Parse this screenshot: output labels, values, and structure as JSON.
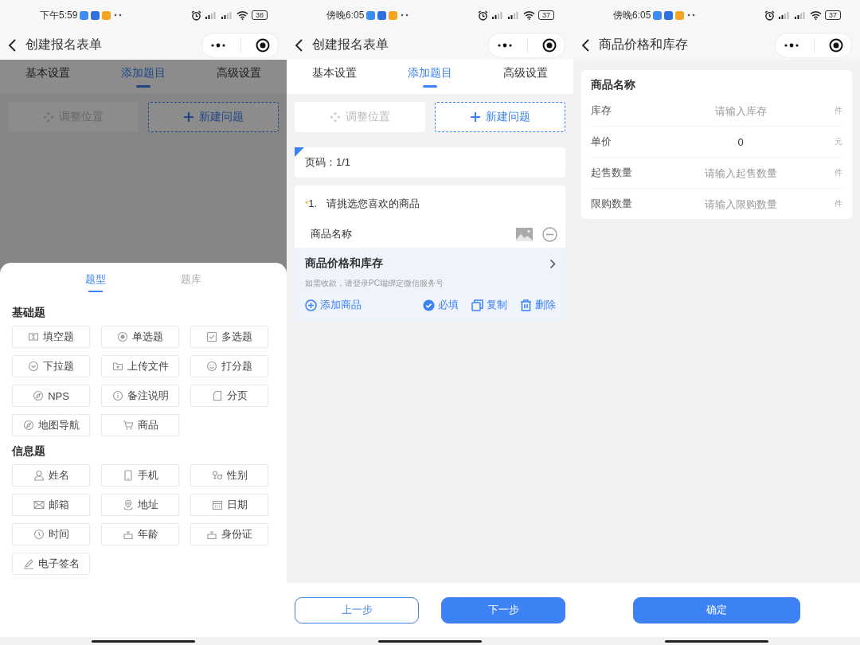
{
  "screens": [
    {
      "kind": "question_types",
      "status_bar": {
        "time": "下午5:59",
        "battery": "38"
      },
      "title": "创建报名表单",
      "tabs": [
        {
          "label": "基本设置",
          "selected": false
        },
        {
          "label": "添加题目",
          "selected": true
        },
        {
          "label": "高级设置",
          "selected": false
        }
      ],
      "actions": [
        {
          "label": "调整位置",
          "disabled": true
        },
        {
          "label": "新建问题",
          "disabled": false
        }
      ],
      "sheet": {
        "tabs": [
          {
            "label": "题型",
            "selected": true
          },
          {
            "label": "题库",
            "selected": false
          }
        ],
        "groups": [
          {
            "title": "基础题",
            "items": [
              "填空题",
              "单选题",
              "多选题",
              "下拉题",
              "上传文件",
              "打分题",
              "NPS",
              "备注说明",
              "分页",
              "地图导航",
              "商品"
            ]
          },
          {
            "title": "信息题",
            "items": [
              "姓名",
              "手机",
              "性别",
              "邮箱",
              "地址",
              "日期",
              "时间",
              "年龄",
              "身份证",
              "电子签名"
            ]
          }
        ]
      }
    },
    {
      "kind": "editor",
      "status_bar": {
        "time": "傍晚6:05",
        "battery": "37"
      },
      "title": "创建报名表单",
      "tabs": [
        {
          "label": "基本设置",
          "selected": false
        },
        {
          "label": "添加题目",
          "selected": true
        },
        {
          "label": "高级设置",
          "selected": false
        }
      ],
      "actions": [
        {
          "label": "调整位置",
          "disabled": true
        },
        {
          "label": "新建问题",
          "disabled": false
        }
      ],
      "page_label": "页码：1/1",
      "question": {
        "required_mark": "*",
        "number": "1.",
        "title": "请挑选您喜欢的商品",
        "options": [
          "商品名称"
        ],
        "price_section": {
          "title": "商品价格和库存",
          "hint": "如需收款，请登录PC端绑定微信服务号"
        },
        "tools": [
          {
            "kind": "add",
            "label": "添加商品"
          },
          {
            "kind": "required",
            "label": "必填",
            "checked": true
          },
          {
            "kind": "copy",
            "label": "复制"
          },
          {
            "kind": "delete",
            "label": "删除"
          }
        ]
      },
      "footer": [
        {
          "kind": "secondary",
          "label": "上一步"
        },
        {
          "kind": "primary",
          "label": "下一步"
        }
      ]
    },
    {
      "kind": "stock",
      "status_bar": {
        "time": "傍晚6:05",
        "battery": "37"
      },
      "title": "商品价格和库存",
      "card_title": "商品名称",
      "fields": [
        {
          "label": "库存",
          "placeholder": "请输入库存",
          "unit": "件"
        },
        {
          "label": "单价",
          "value": "0",
          "unit": "元"
        },
        {
          "label": "起售数量",
          "placeholder": "请输入起售数量",
          "unit": "件"
        },
        {
          "label": "限购数量",
          "placeholder": "请输入限购数量",
          "unit": "件"
        }
      ],
      "footer": [
        {
          "kind": "primary",
          "label": "确定"
        }
      ]
    }
  ]
}
